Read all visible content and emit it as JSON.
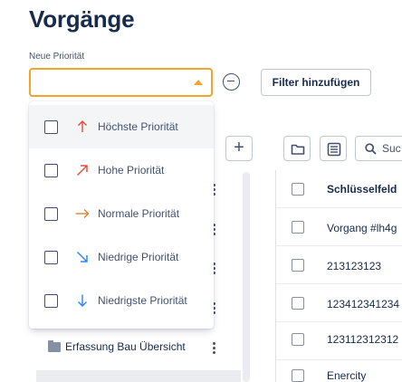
{
  "page": {
    "title": "Vorgänge"
  },
  "filter": {
    "label": "Neue Priorität",
    "value": "",
    "add_filter_label": "Filter hinzufügen"
  },
  "priority_options": [
    {
      "label": "Höchste Priorität",
      "icon": "arrow-up-icon",
      "color": "#e5493a",
      "checked": false
    },
    {
      "label": "Hohe Priorität",
      "icon": "arrow-up-right-icon",
      "color": "#e5493a",
      "checked": false
    },
    {
      "label": "Normale Priorität",
      "icon": "arrow-right-icon",
      "color": "#e97f33",
      "checked": false
    },
    {
      "label": "Niedrige Priorität",
      "icon": "arrow-down-right-icon",
      "color": "#2d8738",
      "checked": false
    },
    {
      "label": "Niedrigste Priorität",
      "icon": "arrow-down-icon",
      "color": "#2684ff",
      "checked": false
    }
  ],
  "tree": {
    "visible_item": "Erfassung Bau Übersicht"
  },
  "toolbar": {
    "search_label": "Suc"
  },
  "table": {
    "header": "Schlüsselfeld",
    "rows": [
      "Vorgang #lh4g",
      "213123123",
      "123412341234",
      "123112312312",
      "Enercity"
    ]
  },
  "colors": {
    "accent": "#f2a52b",
    "text": "#172b4d"
  }
}
